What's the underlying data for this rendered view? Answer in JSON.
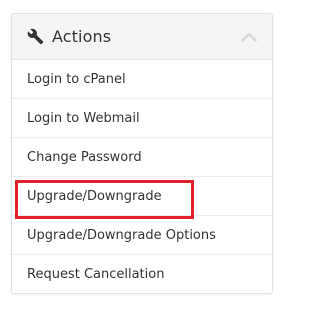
{
  "panel": {
    "title": "Actions",
    "header_icon": "wrench-icon",
    "collapse_icon": "chevron-up-icon",
    "items": [
      {
        "label": "Login to cPanel"
      },
      {
        "label": "Login to Webmail"
      },
      {
        "label": "Change Password"
      },
      {
        "label": "Upgrade/Downgrade",
        "highlighted": true
      },
      {
        "label": "Upgrade/Downgrade Options"
      },
      {
        "label": "Request Cancellation"
      }
    ]
  },
  "colors": {
    "text": "#333333",
    "header_bg": "#f5f5f5",
    "border": "#dfe3e7",
    "highlight": "#e0202a"
  }
}
